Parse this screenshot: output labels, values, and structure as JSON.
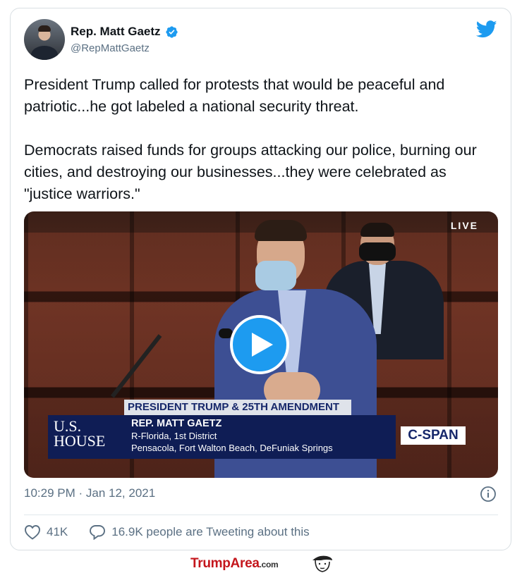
{
  "tweet": {
    "author_name": "Rep. Matt Gaetz",
    "handle": "@RepMattGaetz",
    "paragraphs": [
      "President Trump called for protests that would be peaceful and patriotic...he got labeled a national security threat.",
      "Democrats raised funds for groups attacking our police, burning our cities, and destroying our businesses...they were celebrated as \"justice warriors.\""
    ],
    "timestamp": "10:29 PM · Jan 12, 2021",
    "likes": "41K",
    "retweet_text": "16.9K people are Tweeting about this"
  },
  "video": {
    "live_label": "LIVE",
    "chyron_topic": "PRESIDENT TRUMP & 25TH AMENDMENT",
    "chyron_name": "REP. MATT GAETZ",
    "chyron_district": "R-Florida, 1st District",
    "chyron_towns": "Pensacola, Fort Walton Beach, DeFuniak Springs",
    "logo_line1": "U.S.",
    "logo_line2": "HOUSE",
    "network": "C-SPAN"
  },
  "footer": {
    "brand_main": "TrumpArea",
    "brand_suffix": ".com"
  },
  "colors": {
    "accent": "#1d9bf0",
    "text": "#0f1419",
    "muted": "#5b7083",
    "brand_red": "#c4161c"
  },
  "icons": [
    "verified-icon",
    "twitter-bird-icon",
    "play-icon",
    "info-icon",
    "heart-icon",
    "reply-icon"
  ]
}
